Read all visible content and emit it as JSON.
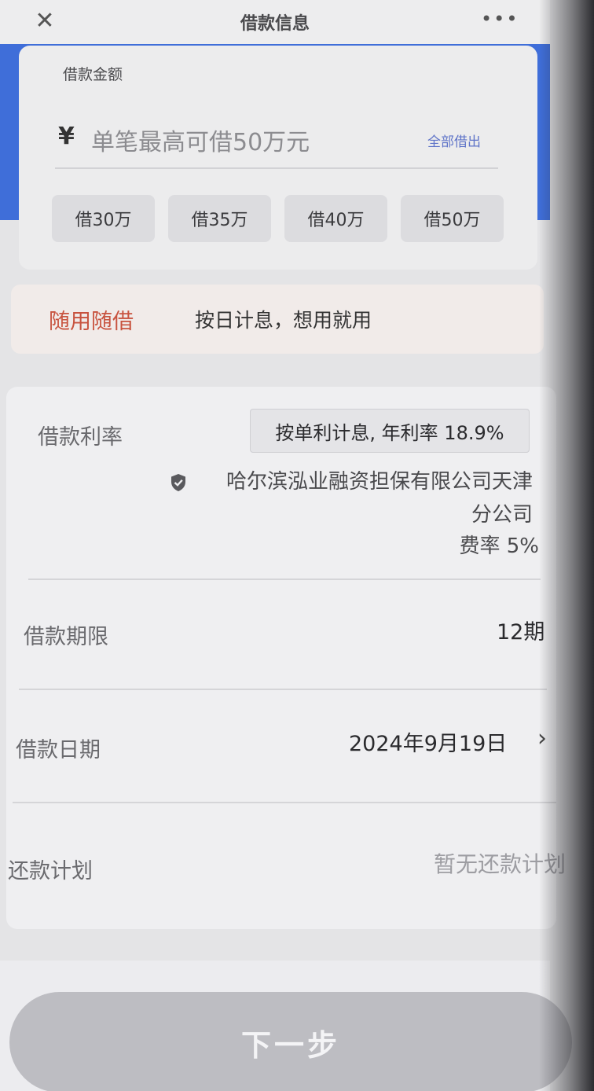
{
  "topbar": {
    "title": "借款信息",
    "close_icon": "close-icon",
    "more_icon": "more-icon"
  },
  "amount": {
    "label": "借款金额",
    "currency": "¥",
    "placeholder": "单笔最高可借50万元",
    "borrow_all": "全部借出",
    "chips": [
      "借30万",
      "借35万",
      "借40万",
      "借50万"
    ]
  },
  "promo": {
    "tag": "随用随借",
    "text": "按日计息，想用就用"
  },
  "details": {
    "rate": {
      "label": "借款利率",
      "value": "按单利计息, 年利率 18.9%",
      "guarantor_line1": "哈尔滨泓业融资担保有限公司天津",
      "guarantor_line2": "分公司",
      "fee_rate": "费率 5%"
    },
    "term": {
      "label": "借款期限",
      "value": "12期"
    },
    "date": {
      "label": "借款日期",
      "value": "2024年9月19日"
    },
    "plan": {
      "label": "还款计划",
      "value": "暂无还款计划"
    }
  },
  "footer": {
    "next_label": "下一步"
  },
  "colors": {
    "accent_blue": "#3f6ed9",
    "promo_red": "#c8533f",
    "button_disabled": "#bdbdc2"
  }
}
